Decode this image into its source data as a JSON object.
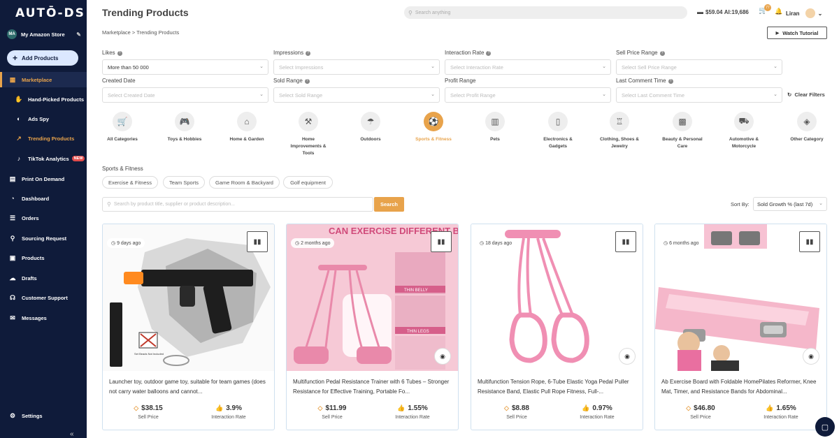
{
  "sidebar": {
    "logo": "AUTŌ-DS",
    "store": {
      "initials": "MA",
      "name": "My Amazon Store"
    },
    "add_products": "Add Products",
    "items": [
      {
        "label": "Marketplace",
        "icon": "marketplace-icon"
      },
      {
        "label": "Hand-Picked Products",
        "icon": "hand-picked-icon"
      },
      {
        "label": "Ads Spy",
        "icon": "ads-spy-icon"
      },
      {
        "label": "Trending Products",
        "icon": "trending-icon"
      },
      {
        "label": "TikTok Analytics",
        "icon": "tiktok-icon",
        "badge": "NEW"
      },
      {
        "label": "Print On Demand",
        "icon": "print-icon"
      },
      {
        "label": "Dashboard",
        "icon": "dashboard-icon"
      },
      {
        "label": "Orders",
        "icon": "orders-icon"
      },
      {
        "label": "Sourcing Request",
        "icon": "sourcing-icon"
      },
      {
        "label": "Products",
        "icon": "products-icon"
      },
      {
        "label": "Drafts",
        "icon": "drafts-icon"
      },
      {
        "label": "Customer Support",
        "icon": "support-icon"
      },
      {
        "label": "Messages",
        "icon": "messages-icon"
      },
      {
        "label": "Settings",
        "icon": "gear-icon"
      }
    ],
    "collapse": "«"
  },
  "header": {
    "title": "Trending Products",
    "search_placeholder": "Search anything",
    "balance": "$59.04",
    "ai_credits": "AI:19,686",
    "cart_count": "77",
    "user_name": "Liran",
    "breadcrumb": "Marketplace > Trending Products",
    "watch_tutorial": "Watch Tutorial"
  },
  "filters": {
    "likes": {
      "label": "Likes",
      "value": "More than 50 000"
    },
    "impressions": {
      "label": "Impressions",
      "placeholder": "Select Impressions"
    },
    "interaction_rate": {
      "label": "Interaction Rate",
      "placeholder": "Select Interaction Rate"
    },
    "sell_price_range": {
      "label": "Sell Price Range",
      "placeholder": "Select Sell Price Range"
    },
    "created_date": {
      "label": "Created Date",
      "placeholder": "Select Created Date"
    },
    "sold_range": {
      "label": "Sold Range",
      "placeholder": "Select Sold Range"
    },
    "profit_range": {
      "label": "Profit Range",
      "placeholder": "Select Profit Range"
    },
    "last_comment_time": {
      "label": "Last Comment Time",
      "placeholder": "Select Last Comment Time"
    },
    "clear_filters": "Clear Filters"
  },
  "categories": [
    {
      "label": "All Categories",
      "icon": "cart-icon"
    },
    {
      "label": "Toys & Hobbies",
      "icon": "gamepad-icon"
    },
    {
      "label": "Home & Garden",
      "icon": "house-icon"
    },
    {
      "label": "Home Improvements & Tools",
      "icon": "tools-icon"
    },
    {
      "label": "Outdoors",
      "icon": "umbrella-icon"
    },
    {
      "label": "Sports & Fitness",
      "icon": "ball-icon",
      "active": true
    },
    {
      "label": "Pets",
      "icon": "pet-icon"
    },
    {
      "label": "Electronics & Gadgets",
      "icon": "phone-icon"
    },
    {
      "label": "Clothing, Shoes & Jewelry",
      "icon": "shirt-icon"
    },
    {
      "label": "Beauty & Personal Care",
      "icon": "beauty-icon"
    },
    {
      "label": "Automotive & Motorcycle",
      "icon": "car-icon"
    },
    {
      "label": "Other Category",
      "icon": "box-icon"
    }
  ],
  "subcategory": {
    "title": "Sports & Fitness",
    "chips": [
      "Exercise & Fitness",
      "Team Sports",
      "Game Room & Backyard",
      "Golf equipment"
    ]
  },
  "product_search": {
    "placeholder": "Search by product title, supplier or product description...",
    "button": "Search"
  },
  "sort": {
    "label": "Sort By:",
    "value": "Sold Growth % (last 7d)"
  },
  "products": [
    {
      "age": "9 days ago",
      "title": "Launcher toy, outdoor game toy, suitable for team games (does not carry water balloons and cannot...",
      "price": "$38.15",
      "price_label": "Sell Price",
      "rate": "3.9%",
      "rate_label": "Interaction Rate",
      "image_color": "#f4f4f4",
      "image_note": "Set Beads Not Included"
    },
    {
      "age": "2 months ago",
      "title": "Multifunction Pedal Resistance Trainer with 6 Tubes – Stronger Resistance for Effective Training, Portable Fo...",
      "price": "$11.99",
      "price_label": "Sell Price",
      "rate": "1.55%",
      "rate_label": "Interaction Rate",
      "image_color": "#f6c9d6",
      "image_headline": "CAN EXERCISE DIFFERENT BODY PARTS",
      "image_tags": [
        "THIN BELLY",
        "THIN LEGS"
      ]
    },
    {
      "age": "18 days ago",
      "title": "Multifunction Tension Rope, 6-Tube Elastic Yoga Pedal Puller Resistance Band, Elastic Pull Rope Fitness, Full-...",
      "price": "$8.88",
      "price_label": "Sell Price",
      "rate": "0.97%",
      "rate_label": "Interaction Rate",
      "image_color": "#ffffff"
    },
    {
      "age": "6 months ago",
      "title": "Ab Exercise Board with Foldable HomePilates Reformer, Knee Mat, Timer, and Resistance Bands for Abdominal...",
      "price": "$46.80",
      "price_label": "Sell Price",
      "rate": "1.65%",
      "rate_label": "Interaction Rate",
      "image_color": "#fbe0e8"
    }
  ]
}
